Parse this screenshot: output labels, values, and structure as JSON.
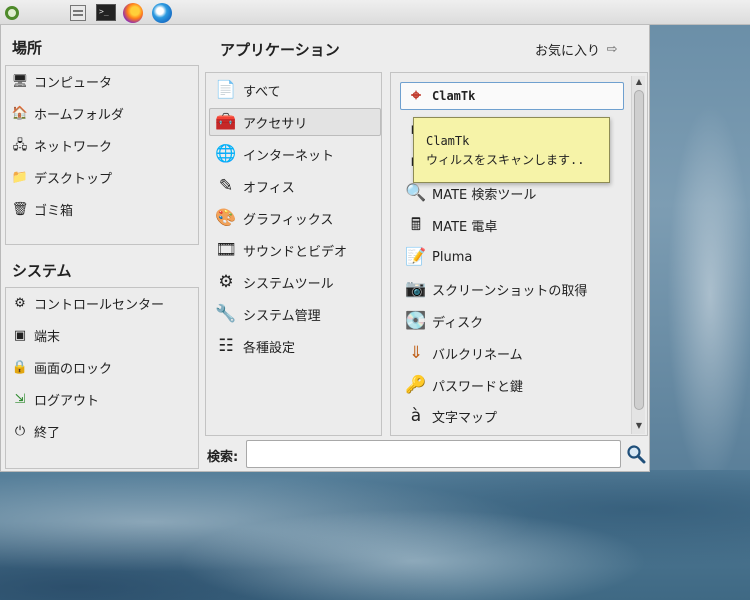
{
  "panel": {
    "launchers": [
      "mate-menu-icon",
      "file-manager-icon",
      "terminal-icon",
      "firefox-icon",
      "thunderbird-icon"
    ],
    "terminal_glyph": ">_"
  },
  "places": {
    "title": "場所",
    "items": [
      {
        "label": "コンピュータ",
        "icon": "computer-icon"
      },
      {
        "label": "ホームフォルダ",
        "icon": "home-folder-icon"
      },
      {
        "label": "ネットワーク",
        "icon": "network-icon"
      },
      {
        "label": "デスクトップ",
        "icon": "desktop-folder-icon"
      },
      {
        "label": "ゴミ箱",
        "icon": "trash-icon"
      }
    ]
  },
  "system": {
    "title": "システム",
    "items": [
      {
        "label": "コントロールセンター",
        "icon": "control-center-icon"
      },
      {
        "label": "端末",
        "icon": "terminal-icon"
      },
      {
        "label": "画面のロック",
        "icon": "lock-screen-icon"
      },
      {
        "label": "ログアウト",
        "icon": "logout-icon"
      },
      {
        "label": "終了",
        "icon": "shutdown-icon"
      }
    ]
  },
  "applications": {
    "title": "アプリケーション",
    "favorites_label": "お気に入り",
    "categories": [
      {
        "label": "すべて",
        "icon": "all-apps-icon"
      },
      {
        "label": "アクセサリ",
        "icon": "accessories-icon",
        "selected": true
      },
      {
        "label": "インターネット",
        "icon": "internet-icon"
      },
      {
        "label": "オフィス",
        "icon": "office-icon"
      },
      {
        "label": "グラフィックス",
        "icon": "graphics-icon"
      },
      {
        "label": "サウンドとビデオ",
        "icon": "sound-video-icon"
      },
      {
        "label": "システムツール",
        "icon": "system-tools-icon"
      },
      {
        "label": "システム管理",
        "icon": "administration-icon"
      },
      {
        "label": "各種設定",
        "icon": "preferences-icon"
      }
    ],
    "apps": [
      {
        "label": "ClamTk",
        "icon": "clamtk-icon",
        "selected": true
      },
      {
        "label": "",
        "icon": "app-icon-hidden-1"
      },
      {
        "label": "",
        "icon": "app-icon-hidden-2"
      },
      {
        "label": "MATE 検索ツール",
        "icon": "search-tool-icon"
      },
      {
        "label": "MATE 電卓",
        "icon": "calculator-icon"
      },
      {
        "label": "Pluma",
        "icon": "text-editor-icon"
      },
      {
        "label": "スクリーンショットの取得",
        "icon": "screenshot-icon"
      },
      {
        "label": "ディスク",
        "icon": "disks-icon"
      },
      {
        "label": "バルクリネーム",
        "icon": "bulk-rename-icon"
      },
      {
        "label": "パスワードと鍵",
        "icon": "passwords-keys-icon"
      },
      {
        "label": "文字マップ",
        "icon": "character-map-icon"
      }
    ]
  },
  "tooltip": {
    "title": "ClamTk",
    "description": "ウィルスをスキャンします.."
  },
  "search": {
    "label": "検索:",
    "value": "",
    "placeholder": ""
  }
}
